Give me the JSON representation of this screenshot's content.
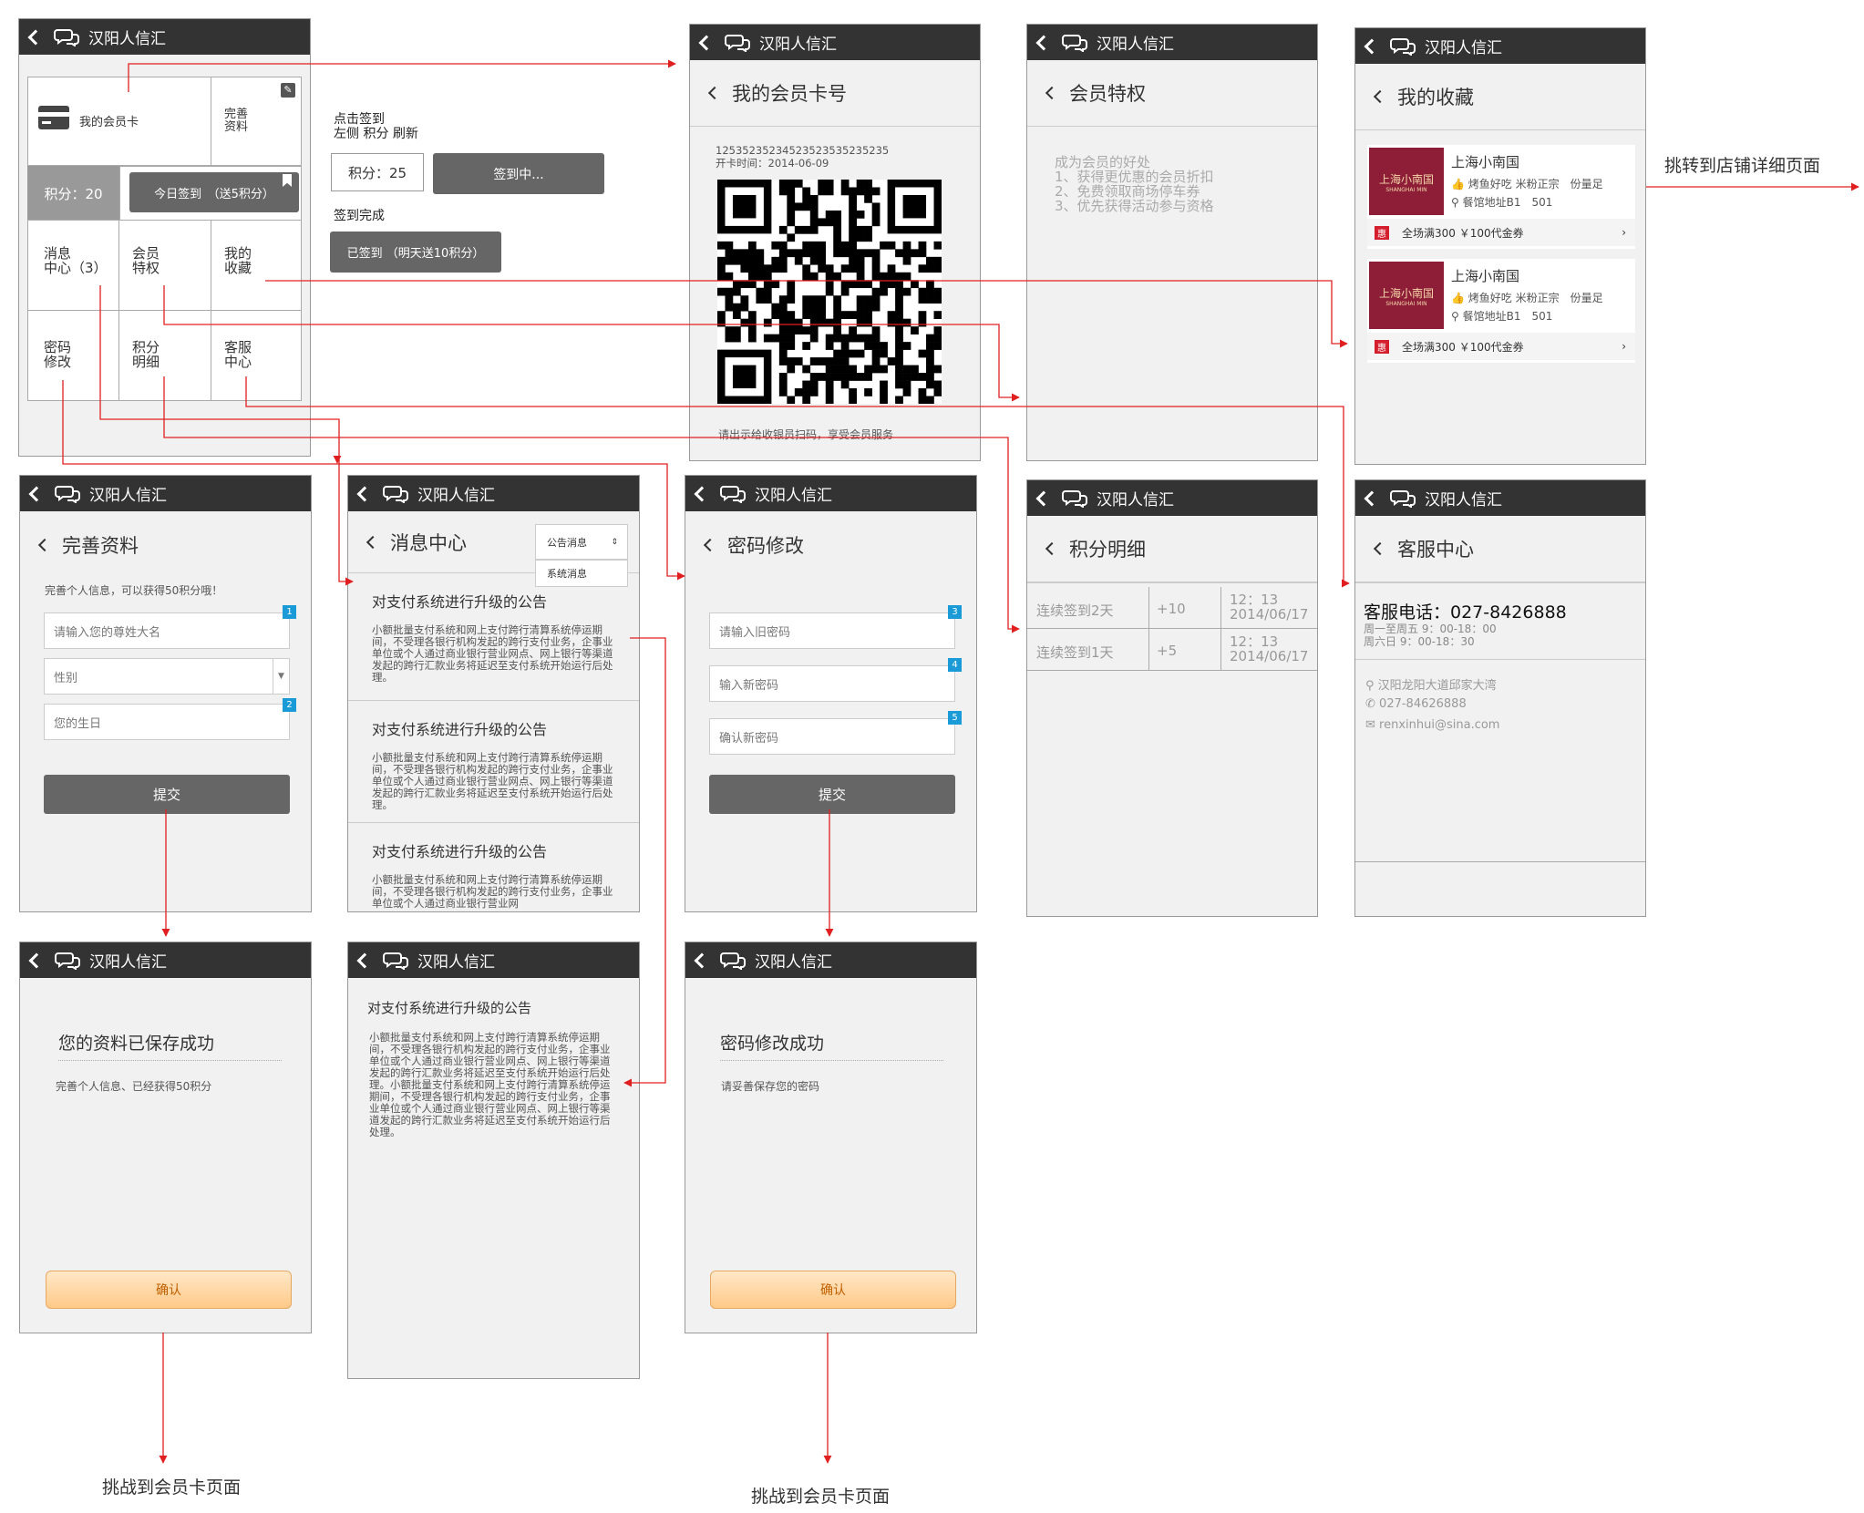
{
  "app_title": "汉阳人信汇",
  "main": {
    "member_card": "我的会员卡",
    "complete_profile": "完善\n资料",
    "points_label": "积分：20",
    "signin_btn": "今日签到　（送5积分）",
    "menu": [
      "消息\n中心（3）",
      "会员\n特权",
      "我的\n收藏",
      "密码\n修改",
      "积分\n明细",
      "客服\n中心"
    ]
  },
  "signin_notes": {
    "hint": "点击签到\n左侧 积分 刷新",
    "points_box": "积分：25",
    "signing_btn": "签到中...",
    "done_label": "签到完成",
    "done_btn": "已签到 （明天送10积分）"
  },
  "card": {
    "header": "我的会员卡号",
    "number": "12535235234523523535235235",
    "open_date": "开卡时间：2014-06-09",
    "footer": "请出示给收银员扫码，享受会员服务"
  },
  "privilege": {
    "header": "会员特权",
    "text": "成为会员的好处\n1、获得更优惠的会员折扣\n2、免费领取商场停车券\n3、优先获得活动参与资格"
  },
  "favorites": {
    "header": "我的收藏",
    "items": [
      {
        "name": "上海小南国",
        "logo": "上海小南国",
        "logo_en": "SHANGHAI MIN",
        "tags": "烤鱼好吃 米粉正宗　份量足",
        "addr": "餐馆地址B1　501",
        "promo_tag": "惠",
        "promo": "全场满300 ￥100代金券"
      },
      {
        "name": "上海小南国",
        "logo": "上海小南国",
        "logo_en": "SHANGHAI MIN",
        "tags": "烤鱼好吃 米粉正宗　份量足",
        "addr": "餐馆地址B1　501",
        "promo_tag": "惠",
        "promo": "全场满300 ￥100代金券"
      }
    ]
  },
  "fav_note": "挑转到店铺详细页面",
  "profile": {
    "header": "完善资料",
    "hint": "完善个人信息，可以获得50积分哦！",
    "name_ph": "请输入您的尊姓大名",
    "gender_ph": "性别",
    "birthday_ph": "您的生日",
    "submit": "提交",
    "b1": "1",
    "b2": "2"
  },
  "messages": {
    "header": "消息中心",
    "dd_opt1": "公告消息",
    "dd_opt2": "系统消息",
    "items": [
      {
        "title": "对支付系统进行升级的公告",
        "body": "小额批量支付系统和网上支付跨行清算系统停运期间，不受理各银行机构发起的跨行支付业务，企事业单位或个人通过商业银行营业网点、网上银行等渠道发起的跨行汇款业务将延迟至支付系统开始运行后处理。"
      },
      {
        "title": "对支付系统进行升级的公告",
        "body": "小额批量支付系统和网上支付跨行清算系统停运期间，不受理各银行机构发起的跨行支付业务，企事业单位或个人通过商业银行营业网点、网上银行等渠道发起的跨行汇款业务将延迟至支付系统开始运行后处理。"
      },
      {
        "title": "对支付系统进行升级的公告",
        "body": "小额批量支付系统和网上支付跨行清算系统停运期间，不受理各银行机构发起的跨行支付业务，企事业单位或个人通过商业银行营业网"
      }
    ]
  },
  "password": {
    "header": "密码修改",
    "old_ph": "请输入旧密码",
    "new_ph": "输入新密码",
    "confirm_ph": "确认新密码",
    "submit": "提交",
    "b3": "3",
    "b4": "4",
    "b5": "5"
  },
  "points": {
    "header": "积分明细",
    "rows": [
      {
        "desc": "连续签到2天",
        "pts": "+10",
        "time": "12：13\n2014/06/17"
      },
      {
        "desc": "连续签到1天",
        "pts": "+5",
        "time": "12：13\n2014/06/17"
      }
    ]
  },
  "service": {
    "header": "客服中心",
    "phone": "客服电话：027-8426888",
    "hours1": "周一至周五 9：00-18：00",
    "hours2": "周六日 9：00-18：30",
    "addr": "汉阳龙阳大道邱家大湾",
    "tel": "027-84626888",
    "email": "renxinhui@sina.com"
  },
  "profile_ok": {
    "title": "您的资料已保存成功",
    "text": "完善个人信息、已经获得50积分",
    "btn": "确认"
  },
  "msg_detail": {
    "title": "对支付系统进行升级的公告",
    "body": "小额批量支付系统和网上支付跨行清算系统停运期间，不受理各银行机构发起的跨行支付业务，企事业单位或个人通过商业银行营业网点、网上银行等渠道发起的跨行汇款业务将延迟至支付系统开始运行后处理。小额批量支付系统和网上支付跨行清算系统停运期间，不受理各银行机构发起的跨行支付业务，企事业单位或个人通过商业银行营业网点、网上银行等渠道发起的跨行汇款业务将延迟至支付系统开始运行后处理。"
  },
  "pwd_ok": {
    "title": "密码修改成功",
    "text": "请妥善保存您的密码",
    "btn": "确认"
  },
  "jump_note1": "挑战到会员卡页面",
  "jump_note2": "挑战到会员卡页面",
  "colors": {
    "titlebar": "#333333",
    "accent_line": "#e02020",
    "badge": "#1a9ad6"
  }
}
